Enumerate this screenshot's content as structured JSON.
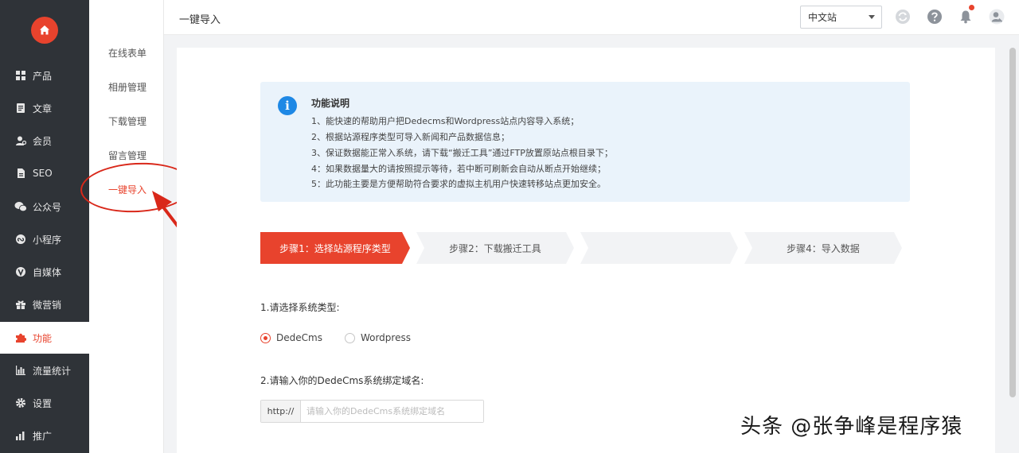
{
  "sidebar": {
    "items": [
      {
        "label": "产品",
        "icon": "grid-icon"
      },
      {
        "label": "文章",
        "icon": "document-icon"
      },
      {
        "label": "会员",
        "icon": "user-icon"
      },
      {
        "label": "SEO",
        "icon": "seo-icon"
      },
      {
        "label": "公众号",
        "icon": "wechat-icon"
      },
      {
        "label": "小程序",
        "icon": "mini-program-icon"
      },
      {
        "label": "自媒体",
        "icon": "v-icon"
      },
      {
        "label": "微营销",
        "icon": "gift-icon"
      },
      {
        "label": "功能",
        "icon": "puzzle-icon"
      },
      {
        "label": "流量统计",
        "icon": "bar-chart-icon"
      },
      {
        "label": "设置",
        "icon": "gear-icon"
      },
      {
        "label": "推广",
        "icon": "promote-icon"
      }
    ],
    "active": "功能"
  },
  "submenu": {
    "items": [
      "在线表单",
      "相册管理",
      "下载管理",
      "留言管理",
      "一键导入"
    ],
    "active": "一键导入"
  },
  "header": {
    "title": "一键导入",
    "language": "中文站"
  },
  "info": {
    "title": "功能说明",
    "lines": [
      "1、能快速的帮助用户把Dedecms和Wordpress站点内容导入系统；",
      "2、根据站源程序类型可导入新闻和产品数据信息；",
      "3、保证数据能正常入系统，请下载“搬迁工具”通过FTP放置原站点根目录下；",
      "4：如果数据量大的请按照提示等待，若中断可刷新会自动从断点开始继续；",
      "5：此功能主要是方便帮助符合要求的虚拟主机用户快速转移站点更加安全。"
    ]
  },
  "steps": [
    "步骤1：选择站源程序类型",
    "步骤2：下载搬迁工具",
    "",
    "步骤4：导入数据"
  ],
  "form": {
    "q1": "1.请选择系统类型:",
    "options": [
      "DedeCms",
      "Wordpress"
    ],
    "selected": "DedeCms",
    "q2": "2.请输入你的DedeCms系统绑定域名:",
    "url_prefix": "http://",
    "url_placeholder": "请输入你的DedeCms系统绑定域名",
    "url_value": ""
  },
  "watermark": "头条 @张争峰是程序猿",
  "colors": {
    "accent": "#e8432d",
    "sidebar": "#2f3338",
    "info_bg": "#eaf3fb",
    "info_icon": "#1e88e5"
  }
}
